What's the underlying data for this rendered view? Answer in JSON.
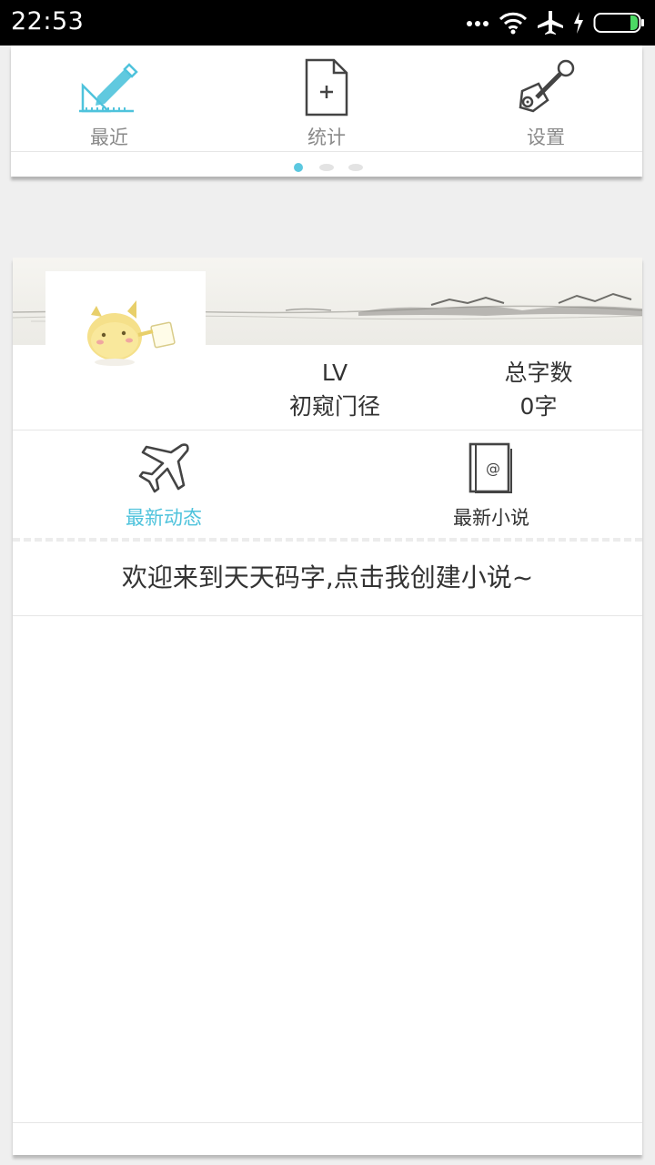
{
  "status_bar": {
    "time": "22:53",
    "icons": [
      "more-dots-icon",
      "wifi-icon",
      "airplane-mode-icon",
      "charging-icon",
      "battery-icon"
    ]
  },
  "top_menu": {
    "items": [
      {
        "label": "最近",
        "icon": "ruler-pencil-icon"
      },
      {
        "label": "统计",
        "icon": "document-plus-icon"
      },
      {
        "label": "设置",
        "icon": "wrench-icon"
      }
    ],
    "pager": {
      "count": 3,
      "active_index": 0
    }
  },
  "profile": {
    "level_label": "LV",
    "level_title": "初窥门径",
    "total_label": "总字数",
    "total_value": "0字"
  },
  "tabs": [
    {
      "label": "最新动态",
      "icon": "airplane-icon",
      "active": true
    },
    {
      "label": "最新小说",
      "icon": "book-at-icon",
      "active": false
    }
  ],
  "welcome_message": "欢迎来到天天码字,点击我创建小说~",
  "colors": {
    "accent": "#4fc3dc",
    "text": "#333333",
    "muted": "#8a8a8a"
  }
}
